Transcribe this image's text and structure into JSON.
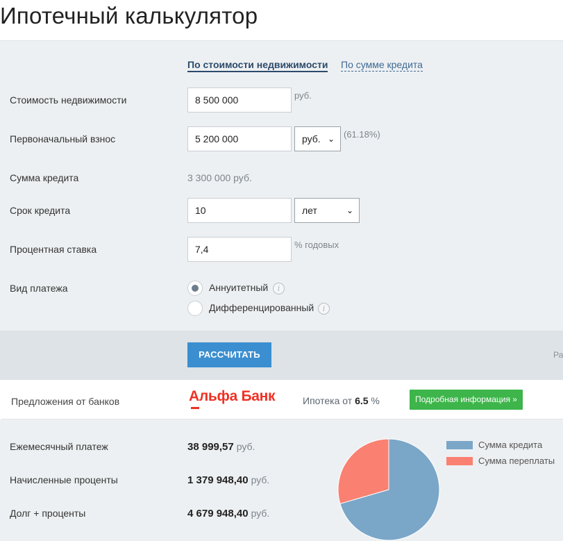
{
  "header": {
    "title": "Ипотечный калькулятор"
  },
  "tabs": {
    "active_label": "По стоимости недвижимости",
    "alt_label": "По сумме кредита"
  },
  "form": {
    "property_cost": {
      "label": "Стоимость недвижимости",
      "value": "8 500 000",
      "unit": "руб."
    },
    "down_payment": {
      "label": "Первоначальный взнос",
      "value": "5 200 000",
      "currency": "руб.",
      "percent": "(61.18%)"
    },
    "loan_amount": {
      "label": "Сумма кредита",
      "value": "3 300 000 руб."
    },
    "term": {
      "label": "Срок кредита",
      "value": "10",
      "unit": "лет"
    },
    "rate": {
      "label": "Процентная ставка",
      "value": "7,4",
      "unit": "% годовых"
    },
    "payment_type": {
      "label": "Вид платежа",
      "options": [
        {
          "label": "Аннуитетный",
          "checked": true
        },
        {
          "label": "Дифференцированный",
          "checked": false
        }
      ]
    }
  },
  "actions": {
    "calculate_label": "РАССЧИТАТЬ",
    "cut_text": "Рас"
  },
  "offers": {
    "label": "Предложения от банков",
    "bank_name": "Альфа Банк",
    "rate_prefix": "Ипотека от",
    "rate_value": "6.5",
    "rate_suffix": "%",
    "details_label": "Подробная информация »"
  },
  "results": {
    "monthly": {
      "label": "Ежемесячный платеж",
      "value": "38 999,57",
      "unit": "руб."
    },
    "interest": {
      "label": "Начисленные проценты",
      "value": "1 379 948,40",
      "unit": "руб."
    },
    "total": {
      "label": "Долг + проценты",
      "value": "4 679 948,40",
      "unit": "руб."
    }
  },
  "chart_data": {
    "type": "pie",
    "categories": [
      "Сумма кредита",
      "Сумма переплаты"
    ],
    "values": [
      3300000,
      1379948.4
    ],
    "colors": [
      "#7aa6c8",
      "#fa8072"
    ],
    "legend": "right"
  },
  "colors": {
    "accent": "#3b8fd0",
    "success": "#3db54a",
    "bank_red": "#ef3124",
    "panel": "#edf0f2"
  },
  "icons": {
    "info": "i",
    "chevron": "⌄"
  }
}
